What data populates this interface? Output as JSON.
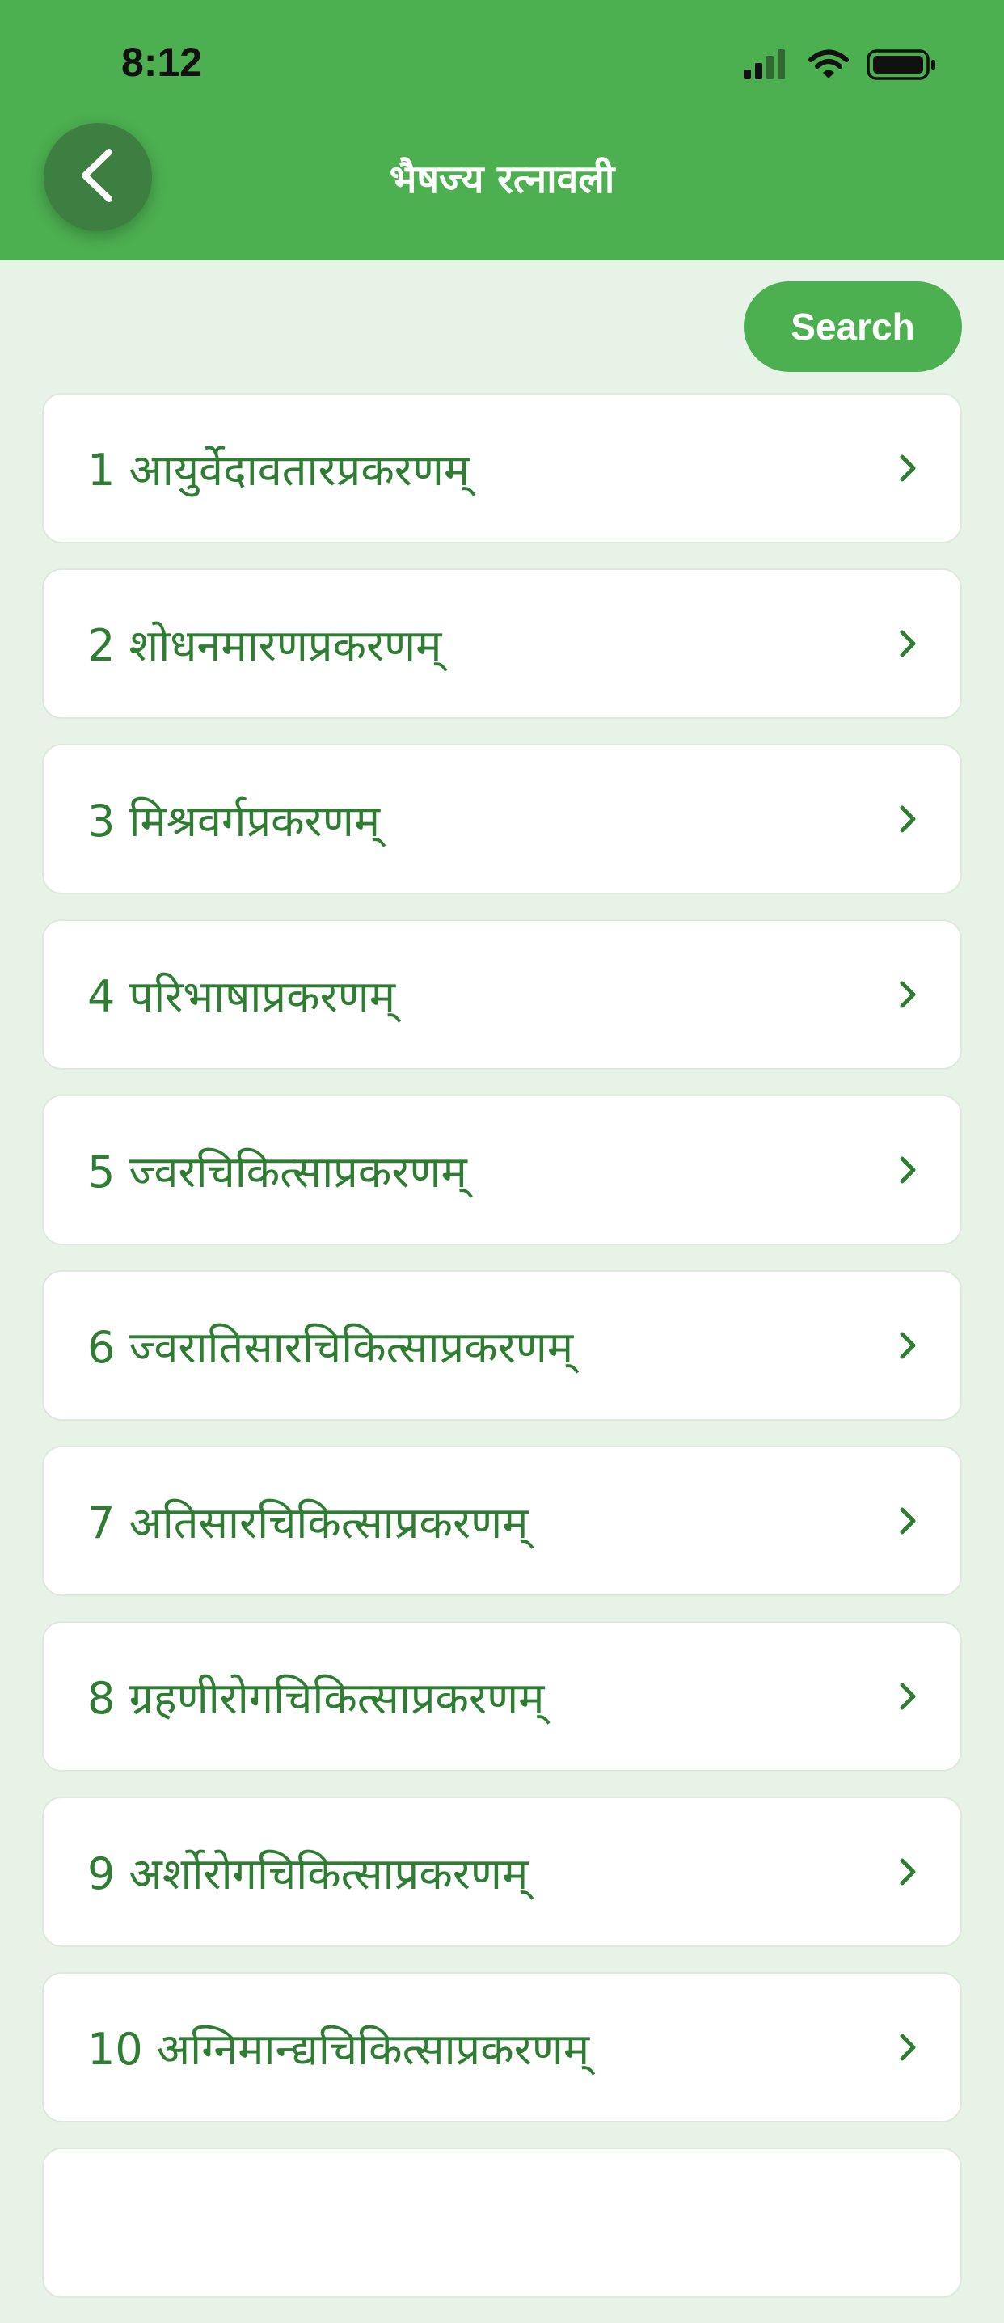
{
  "status_bar": {
    "time": "8:12"
  },
  "header": {
    "title": "भैषज्य रत्नावली",
    "back_icon": "chevron-left-icon",
    "background_color": "#4caf50"
  },
  "search": {
    "label": "Search"
  },
  "chapters": [
    {
      "label": "1 आयुर्वेदावतारप्रकरणम्"
    },
    {
      "label": "2 शोधनमारणप्रकरणम्"
    },
    {
      "label": "3 मिश्रवर्गप्रकरणम्"
    },
    {
      "label": "4 परिभाषाप्रकरणम्"
    },
    {
      "label": "5 ज्वरचिकित्साप्रकरणम्"
    },
    {
      "label": "6 ज्वरातिसारचिकित्साप्रकरणम्"
    },
    {
      "label": "7 अतिसारचिकित्साप्रकरणम्"
    },
    {
      "label": "8 ग्रहणीरोगचिकित्साप्रकरणम्"
    },
    {
      "label": "9 अर्शोरोगचिकित्साप्रकरणम्"
    },
    {
      "label": "10 अग्निमान्द्यचिकित्साप्रकरणम्"
    },
    {
      "label": ""
    }
  ],
  "colors": {
    "accent": "#4caf50",
    "text": "#2e7d32",
    "page_background": "#e8f3e8"
  }
}
